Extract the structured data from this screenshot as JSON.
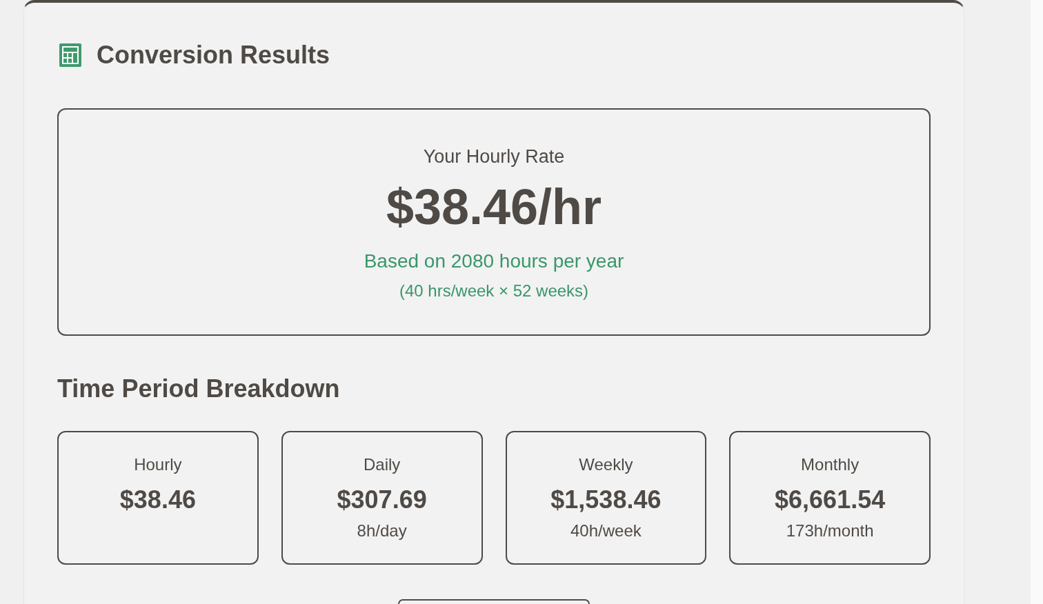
{
  "header": {
    "title": "Conversion Results"
  },
  "hero": {
    "label": "Your Hourly Rate",
    "value": "$38.46/hr",
    "basis": "Based on 2080 hours per year",
    "formula": "(40 hrs/week × 52 weeks)"
  },
  "breakdown": {
    "title": "Time Period Breakdown",
    "periods": [
      {
        "label": "Hourly",
        "amount": "$38.46"
      },
      {
        "label": "Daily",
        "amount": "$307.69",
        "hours": "8h/day"
      },
      {
        "label": "Weekly",
        "amount": "$1,538.46",
        "hours": "40h/week"
      },
      {
        "label": "Monthly",
        "amount": "$6,661.54",
        "hours": "173h/month"
      }
    ]
  }
}
